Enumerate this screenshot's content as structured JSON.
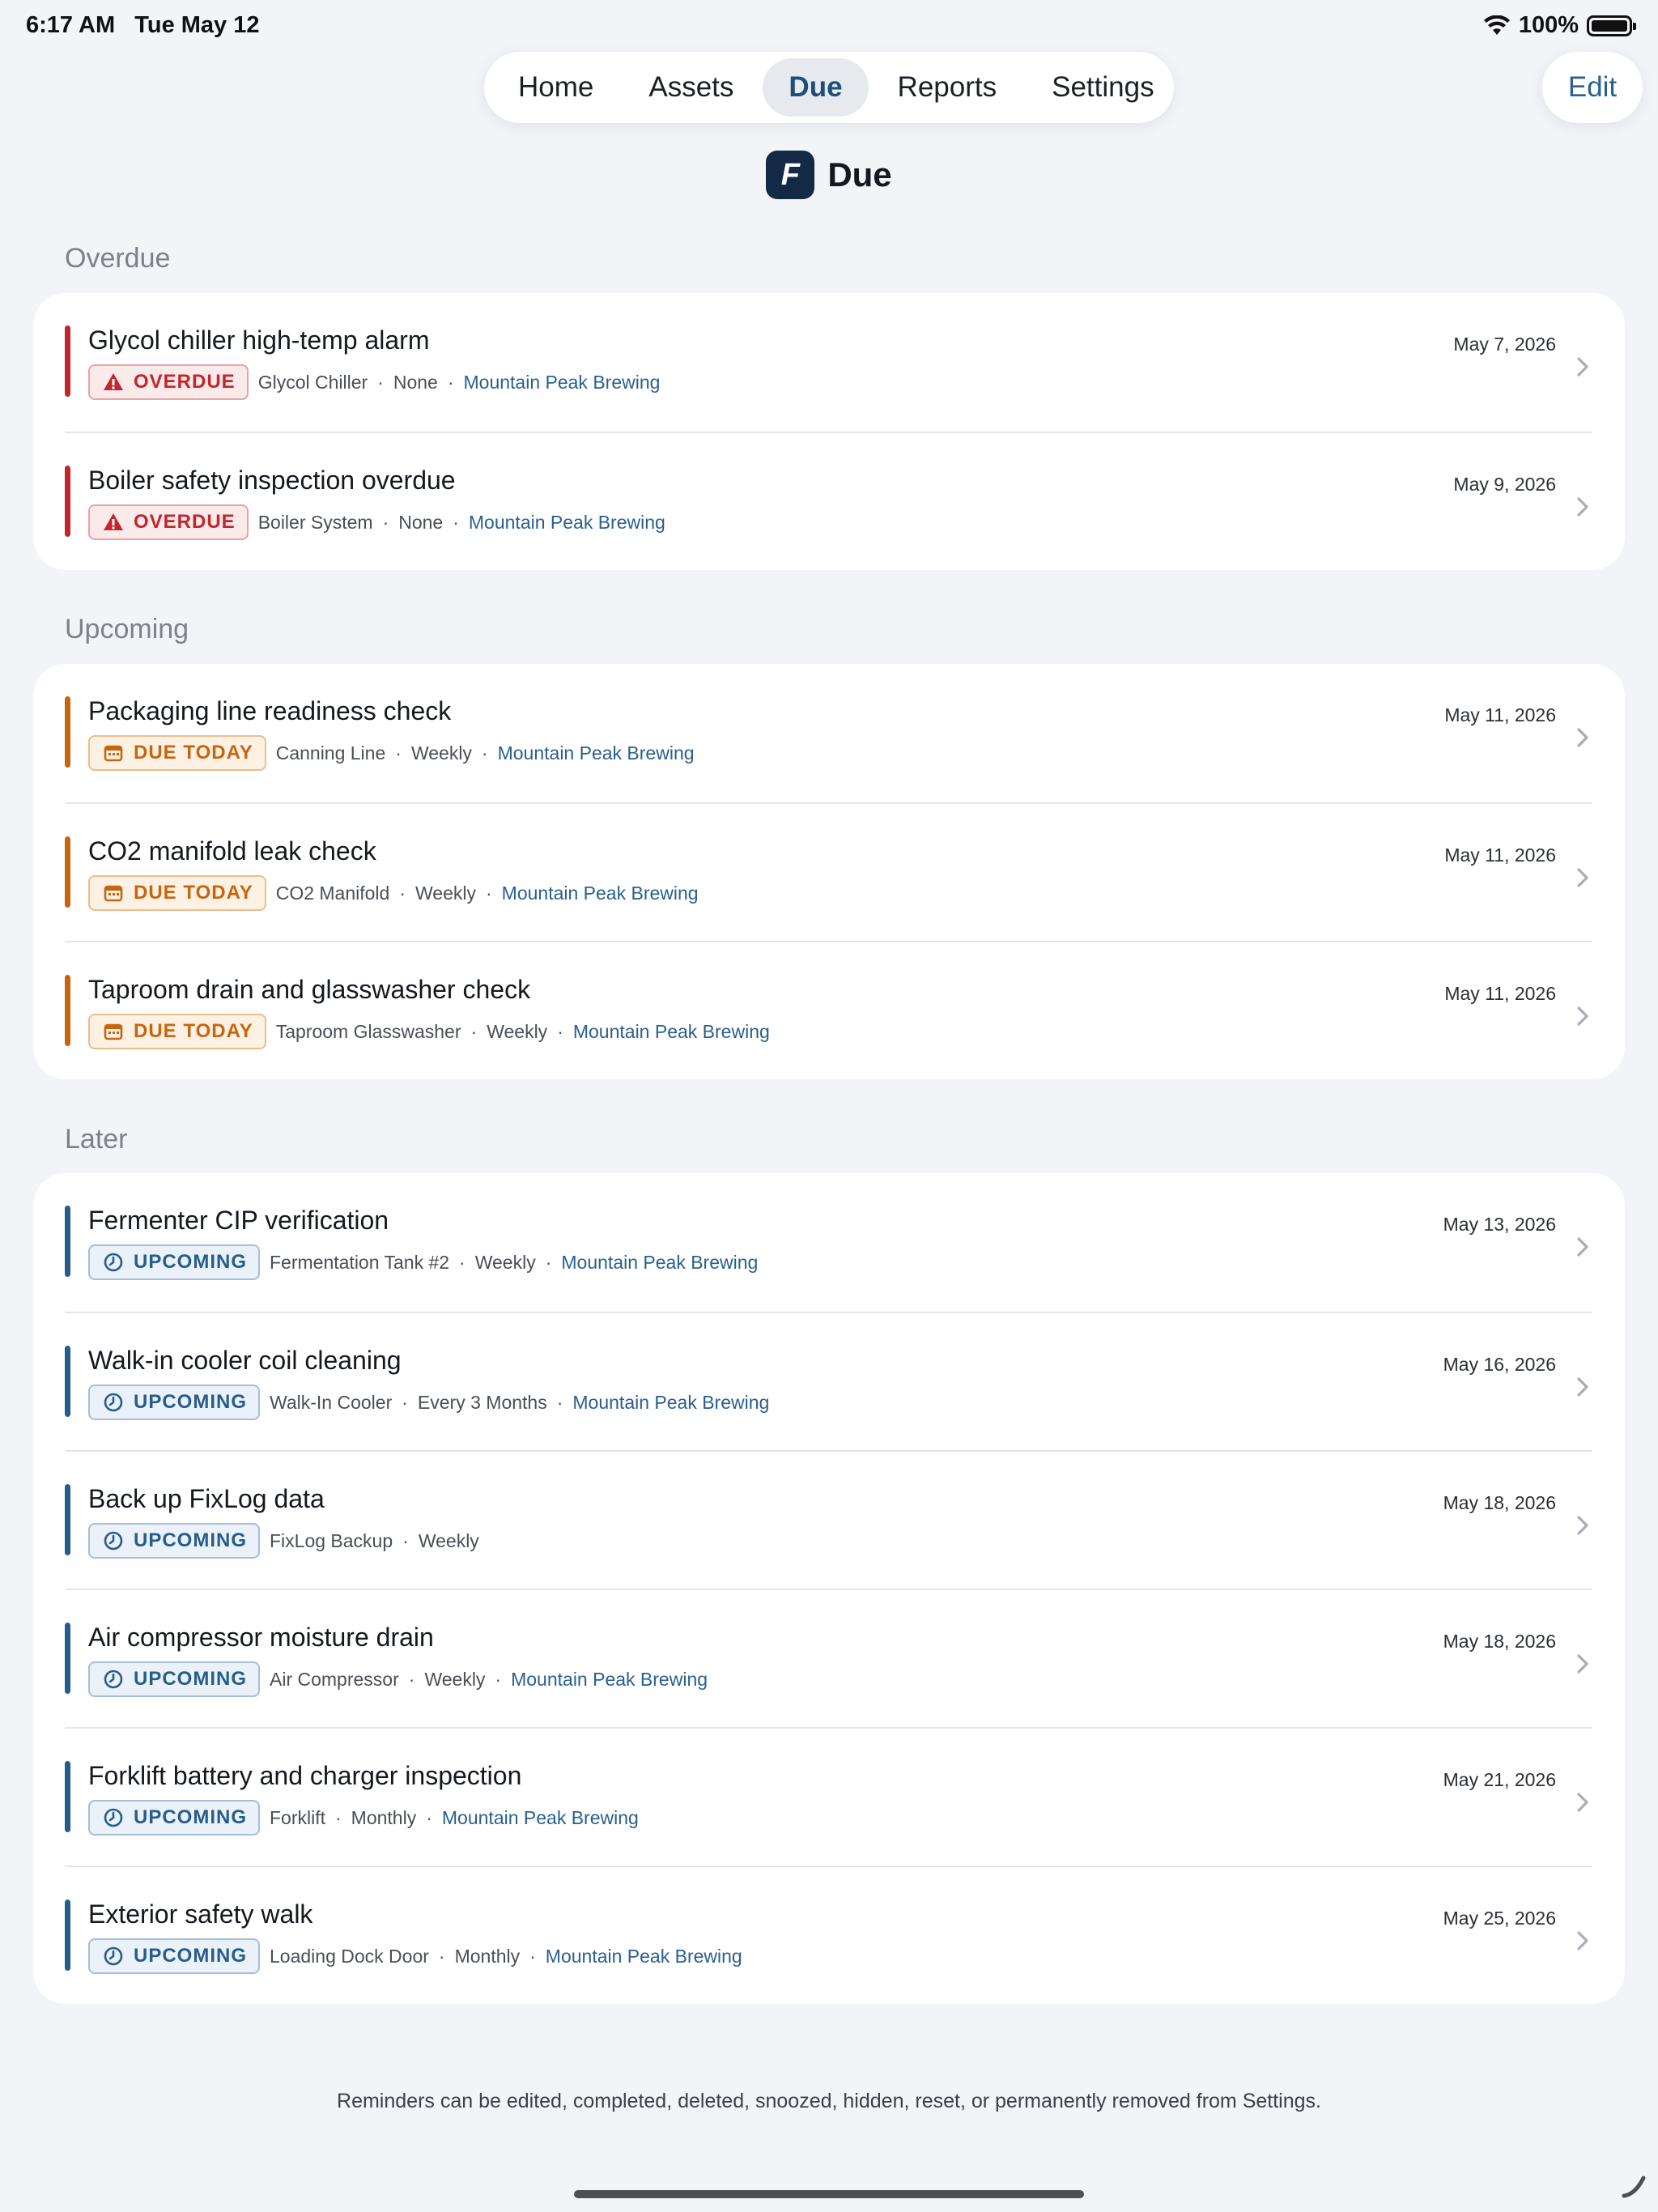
{
  "status_bar": {
    "time": "6:17 AM",
    "date": "Tue May 12",
    "battery": "100%",
    "wifi_icon": "wifi-icon"
  },
  "nav": {
    "tabs": [
      {
        "label": "Home",
        "active": false
      },
      {
        "label": "Assets",
        "active": false
      },
      {
        "label": "Due",
        "active": true
      },
      {
        "label": "Reports",
        "active": false
      },
      {
        "label": "Settings",
        "active": false
      }
    ],
    "edit_label": "Edit"
  },
  "header": {
    "logo_letter": "F",
    "title": "Due"
  },
  "colors": {
    "overdue": "#c0262d",
    "due_today": "#c7650f",
    "upcoming": "#275d8b",
    "location": "#2a5f8f"
  },
  "sections": [
    {
      "label": "Overdue",
      "items": [
        {
          "title": "Glycol chiller high-temp alarm",
          "status": "OVERDUE",
          "status_icon": "warning-icon",
          "asset": "Glycol Chiller",
          "frequency": "None",
          "location": "Mountain Peak Brewing",
          "date": "May 7, 2026"
        },
        {
          "title": "Boiler safety inspection overdue",
          "status": "OVERDUE",
          "status_icon": "warning-icon",
          "asset": "Boiler System",
          "frequency": "None",
          "location": "Mountain Peak Brewing",
          "date": "May 9, 2026"
        }
      ]
    },
    {
      "label": "Upcoming",
      "items": [
        {
          "title": "Packaging line readiness check",
          "status": "DUE TODAY",
          "status_icon": "calendar-icon",
          "asset": "Canning Line",
          "frequency": "Weekly",
          "location": "Mountain Peak Brewing",
          "date": "May 11, 2026"
        },
        {
          "title": "CO2 manifold leak check",
          "status": "DUE TODAY",
          "status_icon": "calendar-icon",
          "asset": "CO2 Manifold",
          "frequency": "Weekly",
          "location": "Mountain Peak Brewing",
          "date": "May 11, 2026"
        },
        {
          "title": "Taproom drain and glasswasher check",
          "status": "DUE TODAY",
          "status_icon": "calendar-icon",
          "asset": "Taproom Glasswasher",
          "frequency": "Weekly",
          "location": "Mountain Peak Brewing",
          "date": "May 11, 2026"
        }
      ]
    },
    {
      "label": "Later",
      "items": [
        {
          "title": "Fermenter CIP verification",
          "status": "UPCOMING",
          "status_icon": "clock-icon",
          "asset": "Fermentation Tank #2",
          "frequency": "Weekly",
          "location": "Mountain Peak Brewing",
          "date": "May 13, 2026"
        },
        {
          "title": "Walk-in cooler coil cleaning",
          "status": "UPCOMING",
          "status_icon": "clock-icon",
          "asset": "Walk-In Cooler",
          "frequency": "Every 3 Months",
          "location": "Mountain Peak Brewing",
          "date": "May 16, 2026"
        },
        {
          "title": "Back up FixLog data",
          "status": "UPCOMING",
          "status_icon": "clock-icon",
          "asset": "FixLog Backup",
          "frequency": "Weekly",
          "location": "",
          "date": "May 18, 2026"
        },
        {
          "title": "Air compressor moisture drain",
          "status": "UPCOMING",
          "status_icon": "clock-icon",
          "asset": "Air Compressor",
          "frequency": "Weekly",
          "location": "Mountain Peak Brewing",
          "date": "May 18, 2026"
        },
        {
          "title": "Forklift battery and charger inspection",
          "status": "UPCOMING",
          "status_icon": "clock-icon",
          "asset": "Forklift",
          "frequency": "Monthly",
          "location": "Mountain Peak Brewing",
          "date": "May 21, 2026"
        },
        {
          "title": "Exterior safety walk",
          "status": "UPCOMING",
          "status_icon": "clock-icon",
          "asset": "Loading Dock Door",
          "frequency": "Monthly",
          "location": "Mountain Peak Brewing",
          "date": "May 25, 2026"
        }
      ]
    }
  ],
  "footer_note": "Reminders can be edited, completed, deleted, snoozed, hidden, reset, or permanently removed from Settings."
}
